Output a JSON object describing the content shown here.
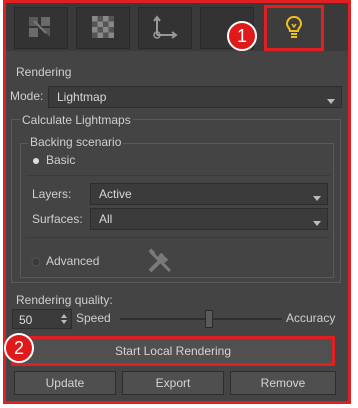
{
  "tabs": [
    {
      "icon": "pattern-icon"
    },
    {
      "icon": "checker-icon"
    },
    {
      "icon": "axis-icon"
    },
    {
      "icon": "blank-tab-icon"
    },
    {
      "icon": "lightbulb-icon"
    }
  ],
  "annotations": {
    "one": "1",
    "two": "2"
  },
  "rendering": {
    "section_label": "Rendering",
    "mode_label": "Mode:",
    "mode_value": "Lightmap"
  },
  "calculate": {
    "section_label": "Calculate Lightmaps",
    "baking_label": "Backing scenario",
    "basic_label": "Basic",
    "layers_label": "Layers:",
    "layers_value": "Active",
    "surfaces_label": "Surfaces:",
    "surfaces_value": "All",
    "advanced_label": "Advanced"
  },
  "quality": {
    "label": "Rendering quality:",
    "value": "50",
    "speed_label": "Speed",
    "accuracy_label": "Accuracy",
    "slider_fraction": 0.55
  },
  "buttons": {
    "start": "Start Local Rendering",
    "update": "Update",
    "export": "Export",
    "remove": "Remove"
  },
  "colors": {
    "highlight": "#e02020",
    "lightbulb": "#f0c020"
  }
}
